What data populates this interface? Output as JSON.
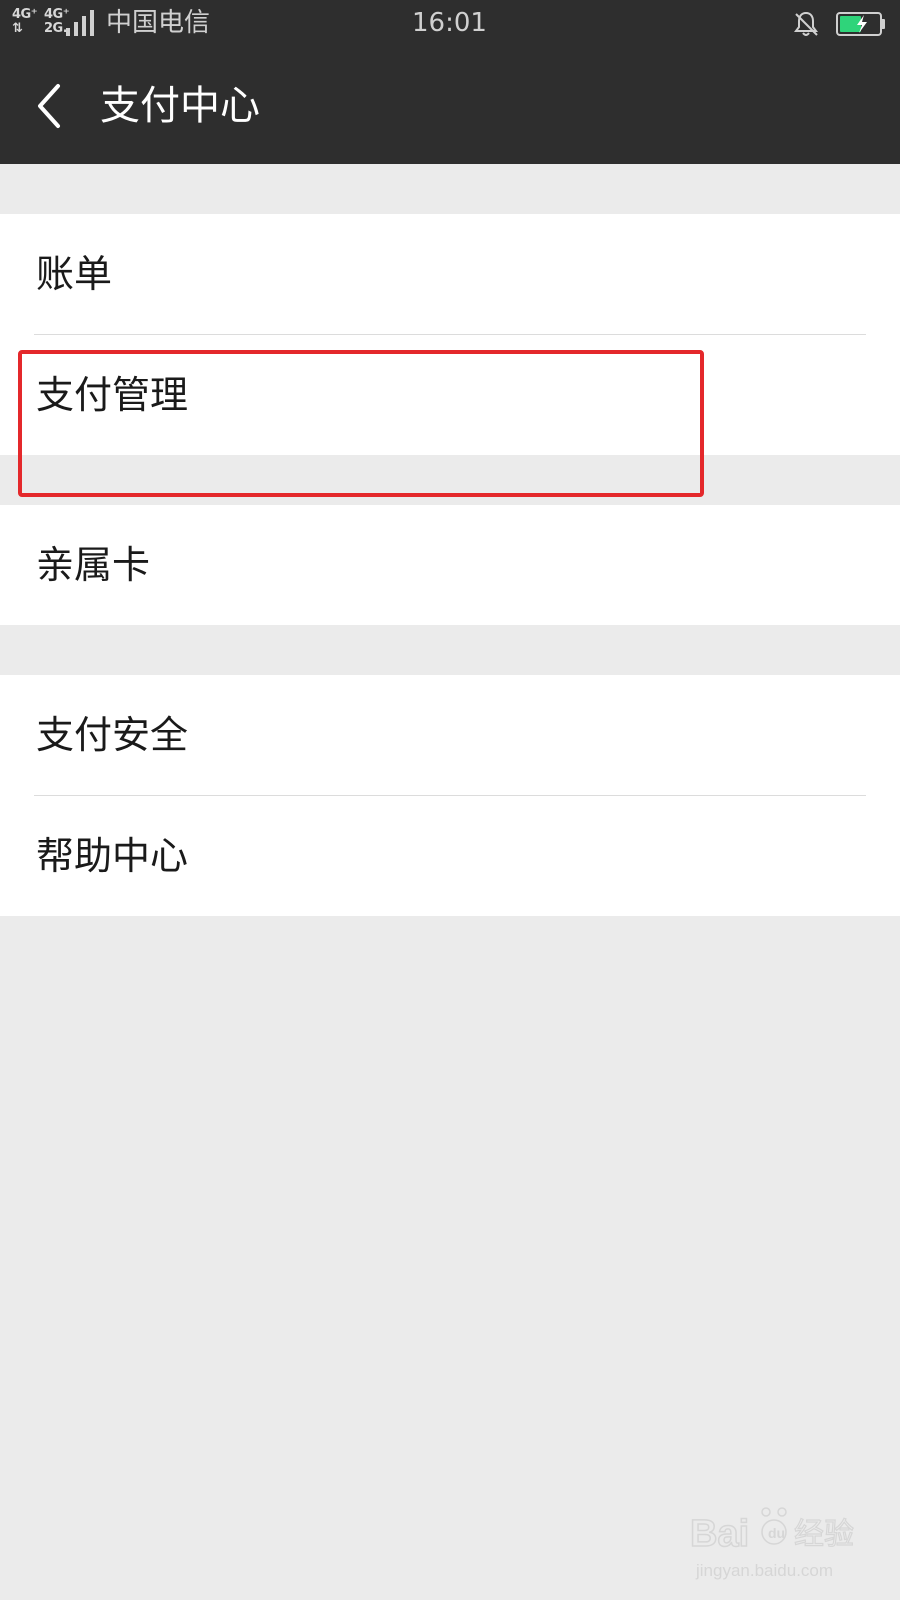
{
  "status_bar": {
    "network_1": "4G⁺",
    "network_2": "4G⁺",
    "network_3": "⇅",
    "network_4": "2G.",
    "carrier": "中国电信",
    "time": "16:01",
    "mute_icon": "bell-off-icon",
    "battery_icon": "battery-charging-icon",
    "battery_color": "#2fd47a",
    "battery_level": 0.55
  },
  "nav": {
    "back_icon": "chevron-left-icon",
    "title": "支付中心"
  },
  "menu": {
    "group1": [
      {
        "label": "账单"
      },
      {
        "label": "支付管理"
      }
    ],
    "group2": [
      {
        "label": "亲属卡"
      }
    ],
    "group3": [
      {
        "label": "支付安全"
      },
      {
        "label": "帮助中心"
      }
    ]
  },
  "annotation": {
    "highlight_color": "#e4282b"
  },
  "watermark": {
    "brand_text": "Baidu经验",
    "url_text": "jingyan.baidu.com"
  }
}
